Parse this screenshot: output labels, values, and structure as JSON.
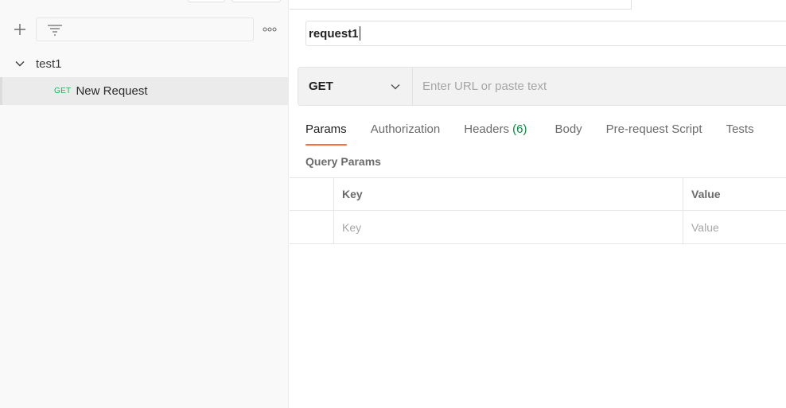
{
  "sidebar": {
    "new_button_icon": "plus-icon",
    "filter_icon": "filter-icon",
    "more_icon": "more-horizontal-icon",
    "collection": {
      "label": "test1",
      "expanded": true
    },
    "requests": [
      {
        "method": "GET",
        "name": "New Request",
        "method_color": "#0cbb52"
      }
    ]
  },
  "request": {
    "name": "request1",
    "method": "GET",
    "url_placeholder": "Enter URL or paste text"
  },
  "tabs": [
    {
      "label": "Params",
      "active": true
    },
    {
      "label": "Authorization"
    },
    {
      "label": "Headers",
      "count": "(6)"
    },
    {
      "label": "Body"
    },
    {
      "label": "Pre-request Script"
    },
    {
      "label": "Tests"
    }
  ],
  "params": {
    "title": "Query Params",
    "columns": {
      "key": "Key",
      "value": "Value"
    },
    "placeholders": {
      "key": "Key",
      "value": "Value"
    }
  },
  "colors": {
    "accent": "#ff6c37",
    "count": "#0b8a3f"
  }
}
